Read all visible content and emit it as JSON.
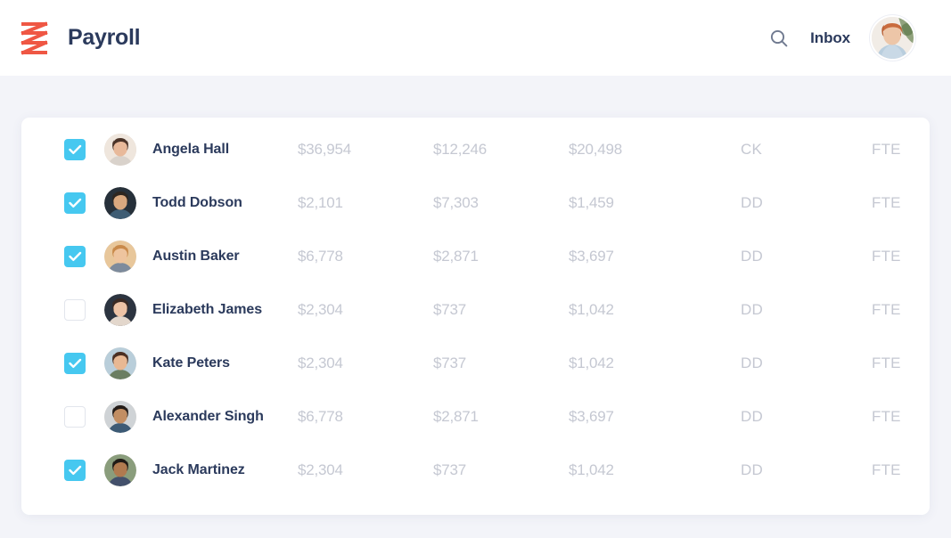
{
  "header": {
    "logo_icon": "zenefits-zigzag-logo",
    "title": "Payroll",
    "search_icon": "search-icon",
    "inbox_label": "Inbox",
    "avatar_alt": "user-avatar"
  },
  "colors": {
    "brand_red": "#ef5744",
    "title_navy": "#2b3a5c",
    "checkbox_cyan": "#46c8f0",
    "muted_gray": "#c5c8d2",
    "page_background": "#f3f4f9",
    "card_background": "#ffffff"
  },
  "table": {
    "rows": [
      {
        "checked": true,
        "name": "Angela Hall",
        "col1": "$36,954",
        "col2": "$12,246",
        "col3": "$20,498",
        "method": "CK",
        "type": "FTE",
        "avatar": {
          "skin": "#e8b99a",
          "hair": "#4a3328",
          "bg": "#efe6dd",
          "shirt": "#d9d2cb"
        }
      },
      {
        "checked": true,
        "name": "Todd Dobson",
        "col1": "$2,101",
        "col2": "$7,303",
        "col3": "$1,459",
        "method": "DD",
        "type": "FTE",
        "avatar": {
          "skin": "#d9a87f",
          "hair": "#2e2620",
          "bg": "#26303a",
          "shirt": "#3f5d74"
        }
      },
      {
        "checked": true,
        "name": "Austin Baker",
        "col1": "$6,778",
        "col2": "$2,871",
        "col3": "$3,697",
        "method": "DD",
        "type": "FTE",
        "avatar": {
          "skin": "#eec49e",
          "hair": "#c98a4b",
          "bg": "#e8c79b",
          "shirt": "#7d8b9c"
        }
      },
      {
        "checked": false,
        "name": "Elizabeth James",
        "col1": "$2,304",
        "col2": "$737",
        "col3": "$1,042",
        "method": "DD",
        "type": "FTE",
        "avatar": {
          "skin": "#edc3a6",
          "hair": "#3b2a24",
          "bg": "#2c3440",
          "shirt": "#e3d7cc"
        }
      },
      {
        "checked": true,
        "name": "Kate Peters",
        "col1": "$2,304",
        "col2": "$737",
        "col3": "$1,042",
        "method": "DD",
        "type": "FTE",
        "avatar": {
          "skin": "#e8b893",
          "hair": "#4b2f22",
          "bg": "#b9ceda",
          "shirt": "#6b7e62"
        }
      },
      {
        "checked": false,
        "name": "Alexander Singh",
        "col1": "$6,778",
        "col2": "$2,871",
        "col3": "$3,697",
        "method": "DD",
        "type": "FTE",
        "avatar": {
          "skin": "#c28e63",
          "hair": "#241c18",
          "bg": "#cfd3d6",
          "shirt": "#3c5a75"
        }
      },
      {
        "checked": true,
        "name": "Jack Martinez",
        "col1": "$2,304",
        "col2": "$737",
        "col3": "$1,042",
        "method": "DD",
        "type": "FTE",
        "avatar": {
          "skin": "#b07a4f",
          "hair": "#1f1a16",
          "bg": "#8a9d7c",
          "shirt": "#43506b"
        }
      }
    ]
  }
}
